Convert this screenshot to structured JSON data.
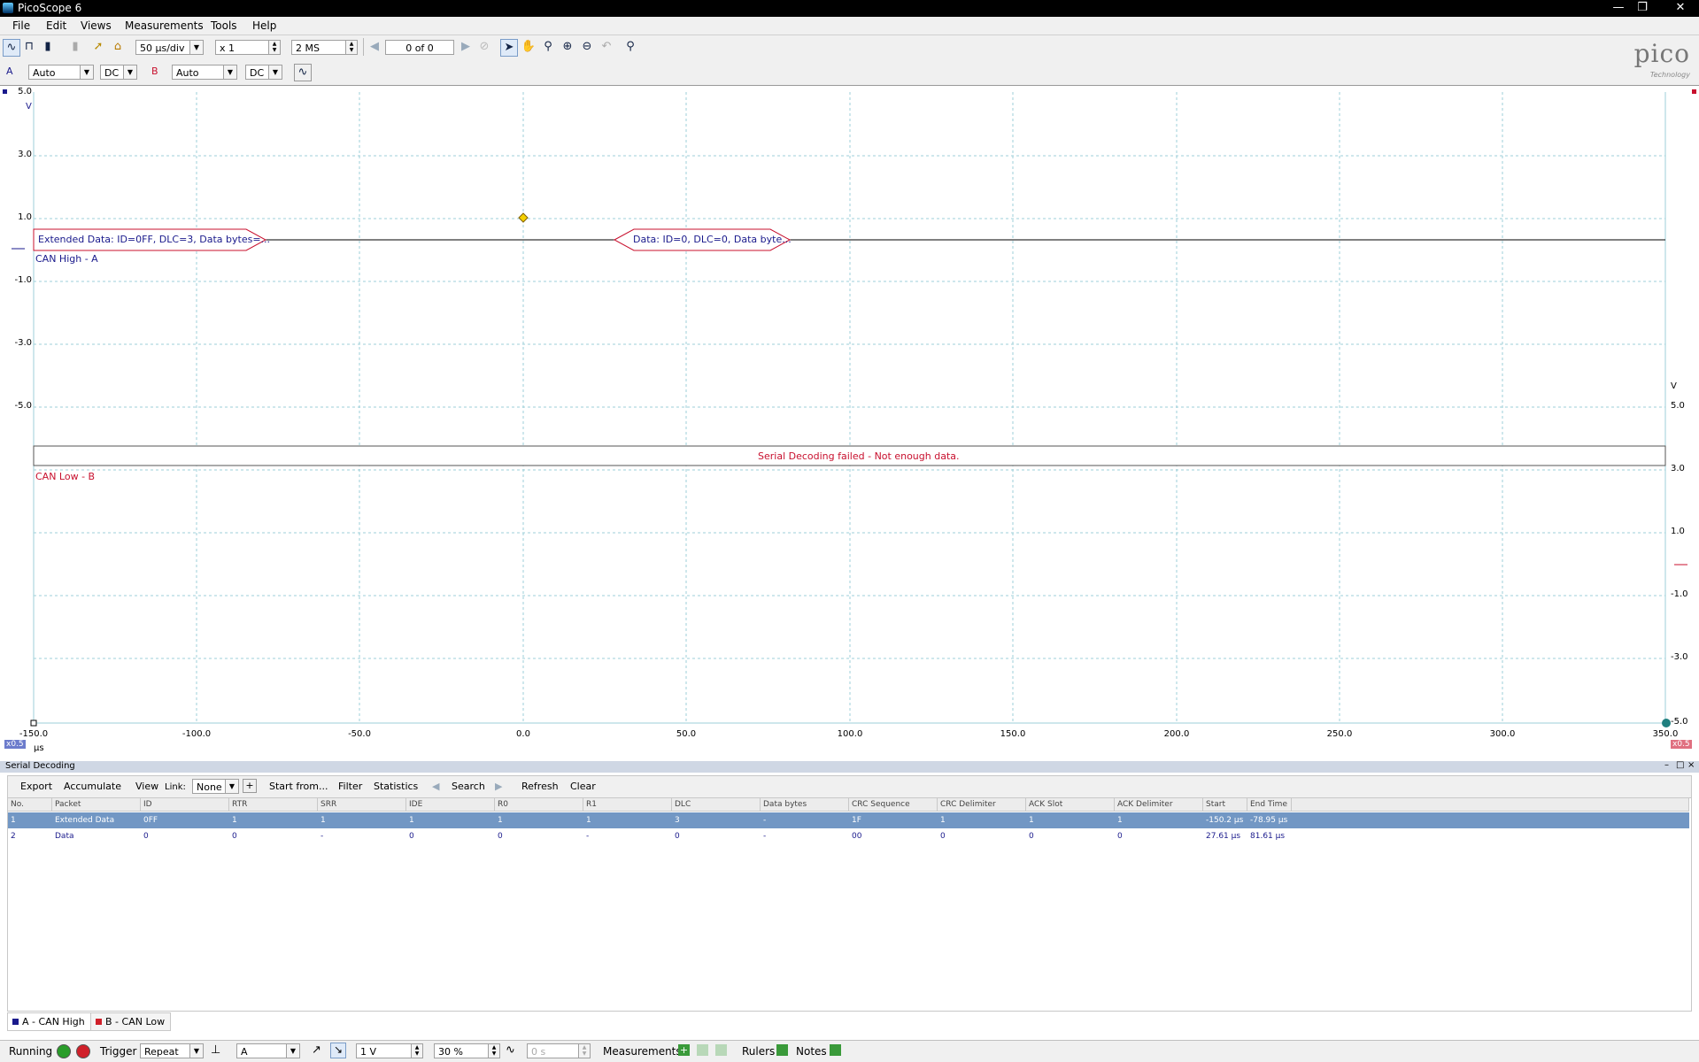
{
  "window": {
    "title": "PicoScope 6"
  },
  "menu": [
    {
      "label": "File"
    },
    {
      "label": "Edit"
    },
    {
      "label": "Views"
    },
    {
      "label": "Measurements"
    },
    {
      "label": "Tools"
    },
    {
      "label": "Help"
    }
  ],
  "toolbar": {
    "timebase": "50 µs/div",
    "zoom": "x 1",
    "samples": "2 MS",
    "buffer": "0 of 0"
  },
  "channels": {
    "a": {
      "label": "A",
      "range": "Auto",
      "coupling": "DC"
    },
    "b": {
      "label": "B",
      "range": "Auto",
      "coupling": "DC"
    }
  },
  "logo": {
    "text": "pico",
    "sub": "Technology"
  },
  "scope": {
    "a_axis_unit": "V",
    "b_axis_unit": "V",
    "x_axis_unit": "µs",
    "a_ticks": [
      "5.0",
      "3.0",
      "1.0",
      "-1.0",
      "-3.0",
      "-5.0"
    ],
    "b_ticks": [
      "5.0",
      "3.0",
      "1.0",
      "-1.0",
      "-3.0",
      "-5.0"
    ],
    "x_ticks": [
      "-150.0",
      "-100.0",
      "-50.0",
      "0.0",
      "50.0",
      "100.0",
      "150.0",
      "200.0",
      "250.0",
      "300.0",
      "350.0"
    ],
    "zoom_a": "x0.5",
    "zoom_b": "x0.5",
    "channel_a_name": "CAN High - A",
    "channel_b_name": "CAN Low - B",
    "decode_a_1": "Extended Data: ID=0FF, DLC=3, Data bytes=...",
    "decode_a_2": "Data: ID=0, DLC=0, Data byte...",
    "decode_b_error": "Serial Decoding failed - Not enough data.",
    "colors": {
      "channel_a": "#1a1a8c",
      "channel_b": "#c8102e",
      "grid": "#9ecfd8"
    }
  },
  "serial_decoding": {
    "title": "Serial Decoding",
    "toolbar": {
      "export": "Export",
      "accumulate": "Accumulate",
      "view": "View",
      "link_label": "Link:",
      "link_value": "None",
      "start_from": "Start from...",
      "filter": "Filter",
      "statistics": "Statistics",
      "search": "Search",
      "refresh": "Refresh",
      "clear": "Clear"
    },
    "columns": [
      "No.",
      "Packet",
      "ID",
      "RTR",
      "SRR",
      "IDE",
      "R0",
      "R1",
      "DLC",
      "Data bytes",
      "CRC Sequence",
      "CRC Delimiter",
      "ACK Slot",
      "ACK Delimiter",
      "Start Time",
      "End Time"
    ],
    "rows": [
      [
        "1",
        "Extended Data",
        "0FF",
        "1",
        "1",
        "1",
        "1",
        "1",
        "3",
        "-",
        "1F",
        "1",
        "1",
        "1",
        "-150.2 µs",
        "-78.95 µs"
      ],
      [
        "2",
        "Data",
        "0",
        "0",
        "-",
        "0",
        "0",
        "-",
        "0",
        "-",
        "00",
        "0",
        "0",
        "0",
        "27.61 µs",
        "81.61 µs"
      ]
    ]
  },
  "channel_tabs": [
    {
      "label": "A - CAN High",
      "color": "#1a1a8c"
    },
    {
      "label": "B - CAN Low",
      "color": "#d0202a"
    }
  ],
  "statusbar": {
    "running": "Running",
    "trigger_label": "Trigger",
    "trigger_mode": "Repeat",
    "trigger_source": "A",
    "threshold": "1 V",
    "pretrigger": "30 %",
    "delay": "0 s",
    "measurements": "Measurements",
    "rulers": "Rulers",
    "notes": "Notes"
  }
}
